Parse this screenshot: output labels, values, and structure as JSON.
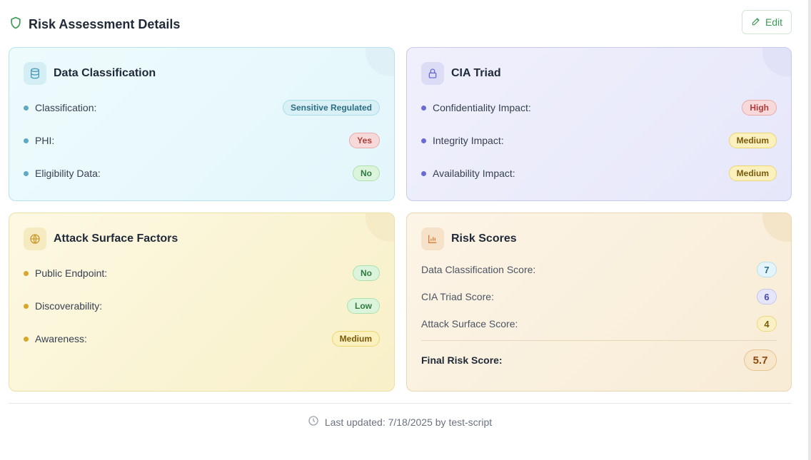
{
  "header": {
    "title": "Risk Assessment Details",
    "edit_label": "Edit"
  },
  "data_classification": {
    "title": "Data Classification",
    "rows": [
      {
        "label": "Classification:",
        "value": "Sensitive Regulated"
      },
      {
        "label": "PHI:",
        "value": "Yes"
      },
      {
        "label": "Eligibility Data:",
        "value": "No"
      }
    ]
  },
  "cia_triad": {
    "title": "CIA Triad",
    "rows": [
      {
        "label": "Confidentiality Impact:",
        "value": "High"
      },
      {
        "label": "Integrity Impact:",
        "value": "Medium"
      },
      {
        "label": "Availability Impact:",
        "value": "Medium"
      }
    ]
  },
  "attack_surface": {
    "title": "Attack Surface Factors",
    "rows": [
      {
        "label": "Public Endpoint:",
        "value": "No"
      },
      {
        "label": "Discoverability:",
        "value": "Low"
      },
      {
        "label": "Awareness:",
        "value": "Medium"
      }
    ]
  },
  "risk_scores": {
    "title": "Risk Scores",
    "rows": [
      {
        "label": "Data Classification Score:",
        "value": "7"
      },
      {
        "label": "CIA Triad Score:",
        "value": "6"
      },
      {
        "label": "Attack Surface Score:",
        "value": "4"
      }
    ],
    "final_label": "Final Risk Score:",
    "final_value": "5.7"
  },
  "footer": {
    "text": "Last updated: 7/18/2025 by test-script"
  },
  "colors": {
    "green_accent": "#3d9a56",
    "high": "#b23b3b",
    "medium": "#7a5a0a",
    "no": "#2f7a3f"
  }
}
